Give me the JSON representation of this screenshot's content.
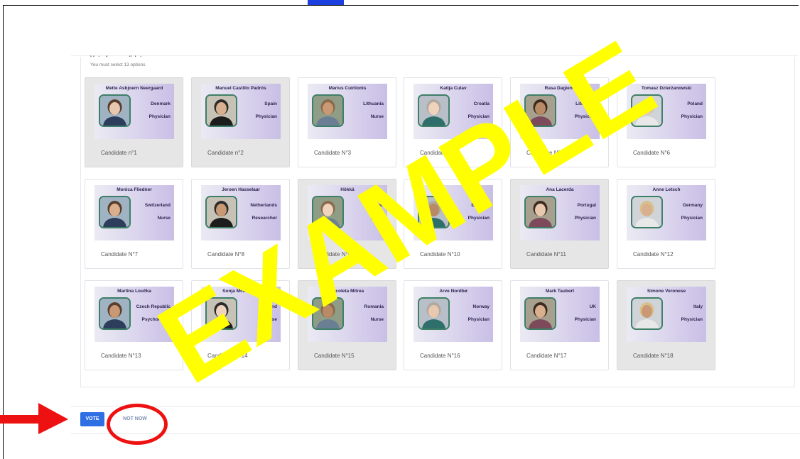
{
  "section": {
    "title": "Vote for candidates",
    "subtitle": "You must select 13 options"
  },
  "candidates": [
    {
      "name": "Mette Asbjoern Neergaard",
      "country": "Denmark",
      "role": "Physician",
      "label": "Candidate n°1",
      "selected": true
    },
    {
      "name": "Manuel Castillo Padrós",
      "country": "Spain",
      "role": "Physician",
      "label": "Candidate n°2",
      "selected": true
    },
    {
      "name": "Marius Cuirlionis",
      "country": "Lithuania",
      "role": "Nurse",
      "label": "Candidate N°3",
      "selected": false
    },
    {
      "name": "Katija Culav",
      "country": "Croatia",
      "role": "Physician",
      "label": "Candidate N°4",
      "selected": false
    },
    {
      "name": "Rasa Dagienė",
      "country": "Lithuania",
      "role": "Physician",
      "label": "Candidate N°5",
      "selected": false
    },
    {
      "name": "Tomasz Dzierżanowski",
      "country": "Poland",
      "role": "Physician",
      "label": "Candidate N°6",
      "selected": false
    },
    {
      "name": "Monica Fliedner",
      "country": "Switzerland",
      "role": "Nurse",
      "label": "Candidate N°7",
      "selected": false
    },
    {
      "name": "Jeroen Hasselaar",
      "country": "Netherlands",
      "role": "Researcher",
      "label": "Candidate N°8",
      "selected": false
    },
    {
      "name": "Hökkä",
      "country": "Finland",
      "role": "Nurse",
      "label": "Candidate N°9",
      "selected": true
    },
    {
      "name": "",
      "country": "Belgium",
      "role": "Physician",
      "label": "Candidate N°10",
      "selected": false
    },
    {
      "name": "Ana Lacerda",
      "country": "Portugal",
      "role": "Physician",
      "label": "Candidate N°11",
      "selected": true
    },
    {
      "name": "Anne Letsch",
      "country": "Germany",
      "role": "Physician",
      "label": "Candidate N°12",
      "selected": false
    },
    {
      "name": "Martina Loučka",
      "country": "Czech Republic",
      "role": "Psychologist",
      "label": "Candidate N°13",
      "selected": false
    },
    {
      "name": "Sonja McIlfatrick",
      "country": "Ireland",
      "role": "Nurse",
      "label": "Candidate N°14",
      "selected": false
    },
    {
      "name": "Nicoleta Mitrea",
      "country": "Romania",
      "role": "Nurse",
      "label": "Candidate N°15",
      "selected": true
    },
    {
      "name": "Arve Nordbø",
      "country": "Norway",
      "role": "Physician",
      "label": "Candidate N°16",
      "selected": false
    },
    {
      "name": "Mark Taubert",
      "country": "UK",
      "role": "Physician",
      "label": "Candidate N°17",
      "selected": false
    },
    {
      "name": "Simone Veronese",
      "country": "Italy",
      "role": "Physician",
      "label": "Candidate N°18",
      "selected": true
    }
  ],
  "actions": {
    "vote_label": "VOTE",
    "not_now_label": "NOT NOW"
  },
  "watermark": {
    "text": "EXAMPLE",
    "color": "#ffff00"
  },
  "colors": {
    "primary": "#2f6fe4",
    "annotation": "#ee1111",
    "card_selected": "#e6e6e6",
    "photo_border": "#3e7f67"
  }
}
